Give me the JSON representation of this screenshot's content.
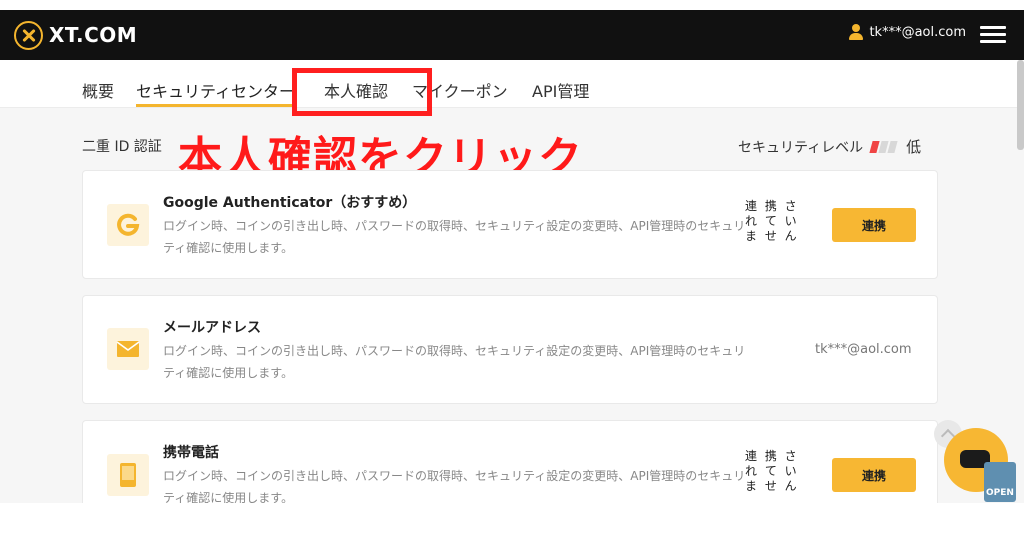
{
  "header": {
    "logo_text": "XT.COM",
    "user_email": "tk***@aol.com",
    "brand_color": "#f4b52e"
  },
  "tabs": [
    {
      "label": "概要"
    },
    {
      "label": "セキュリティセンター"
    },
    {
      "label": "本人確認"
    },
    {
      "label": "マイクーポン"
    },
    {
      "label": "API管理"
    }
  ],
  "annotation": {
    "text": "本人確認をクリック",
    "color": "#ff1a1a"
  },
  "section": {
    "title": "二重 ID 認証",
    "level_label": "セキュリティレベル",
    "level_value": "低",
    "level_bars": [
      "#f04545",
      "#d8d8d8",
      "#d8d8d8"
    ]
  },
  "cards": [
    {
      "title": "Google Authenticator（おすすめ）",
      "desc": "ログイン時、コインの引き出し時、パスワードの取得時、セキュリティ設定の変更時、API管理時のセキュリティ確認に使用します。",
      "status": "連 携 さ れ て い ま せ ん",
      "button": "連携",
      "icon": "google-icon"
    },
    {
      "title": "メールアドレス",
      "desc": "ログイン時、コインの引き出し時、パスワードの取得時、セキュリティ設定の変更時、API管理時のセキュリティ確認に使用します。",
      "status": "tk***@aol.com",
      "icon": "mail-icon"
    },
    {
      "title": "携帯電話",
      "desc": "ログイン時、コインの引き出し時、パスワードの取得時、セキュリティ設定の変更時、API管理時のセキュリティ確認に使用します。",
      "status": "連 携 さ れ て い ま せ ん",
      "button": "連携",
      "icon": "phone-icon"
    }
  ],
  "floating": {
    "open_badge": "OPEN"
  }
}
